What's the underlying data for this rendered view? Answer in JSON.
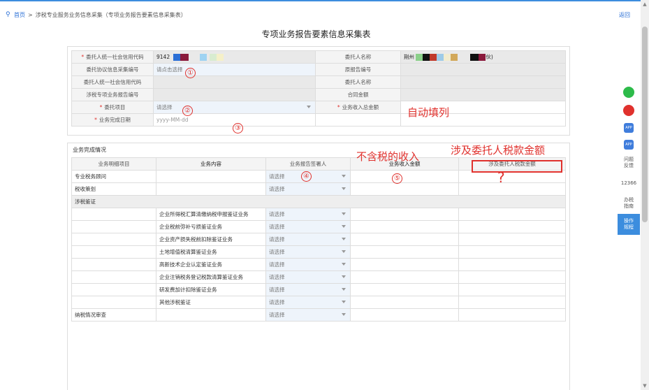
{
  "breadcrumb": {
    "home": "首页",
    "sep": ">",
    "current": "涉税专业服务业务信息采集（专项业务报告要素信息采集表）"
  },
  "return_label": "返回",
  "title": "专项业务报告要素信息采集表",
  "form": {
    "client_credit_code": {
      "label": "委托人统一社会信用代码",
      "value_prefix": "9142"
    },
    "client_name": {
      "label": "委托人名称",
      "value_prefix": "荆州",
      "value_suffix": "伙)"
    },
    "agreement_no": {
      "label": "委托协议信息采集编号",
      "placeholder": "请点击选择"
    },
    "original_report_no": {
      "label": "原报告编号"
    },
    "client_credit_code2": {
      "label": "委托人统一社会信用代码"
    },
    "client_name2": {
      "label": "委托人名称"
    },
    "special_report_no": {
      "label": "涉税专项业务报告编号"
    },
    "contract_amount": {
      "label": "合同金额"
    },
    "entrusted_item": {
      "label": "委托项目",
      "placeholder": "请选择"
    },
    "total_income": {
      "label": "业务收入总金额"
    },
    "completion_date": {
      "label": "业务完成日期",
      "placeholder": "yyyy-MM-dd"
    }
  },
  "annotations": {
    "c1": "①",
    "c2": "②",
    "c3": "③",
    "c4": "④",
    "c5": "⑤",
    "auto_fill": "自动填列",
    "excl_tax": "不含税的收入",
    "client_tax": "涉及委托人税款金额",
    "question": "?"
  },
  "completion": {
    "section_title": "业务完成情况",
    "headers": [
      "业务明细项目",
      "业务内容",
      "业务报告签署人",
      "业务收入金额",
      "涉及委托人税款金额"
    ],
    "select_placeholder": "请选择",
    "rows": [
      {
        "item": "专业税务顾问",
        "content": "",
        "type": "select"
      },
      {
        "item": "税收策划",
        "content": "",
        "type": "select"
      },
      {
        "item": "涉税鉴证",
        "content": "",
        "type": "group"
      },
      {
        "item": "",
        "content": "企业所得税汇算清缴纳税申报鉴证业务",
        "type": "select"
      },
      {
        "item": "",
        "content": "企业税前弥补亏损鉴证业务",
        "type": "select"
      },
      {
        "item": "",
        "content": "企业资产损失税前扣除鉴证业务",
        "type": "select"
      },
      {
        "item": "",
        "content": "土地增值税清算鉴证业务",
        "type": "select"
      },
      {
        "item": "",
        "content": "高新技术企业认定鉴证业务",
        "type": "select"
      },
      {
        "item": "",
        "content": "企业注销税务登记税款清算鉴证业务",
        "type": "select"
      },
      {
        "item": "",
        "content": "研发费加计扣除鉴证业务",
        "type": "select"
      },
      {
        "item": "",
        "content": "其他涉税鉴证",
        "type": "select"
      },
      {
        "item": "纳税情况审查",
        "content": "",
        "type": "select"
      }
    ]
  },
  "sidebar": {
    "app1": "APP",
    "app2": "APP",
    "feedback": "问题反馈",
    "hotline": "12366",
    "guide": "办税指南",
    "manual": "操作规程"
  },
  "colors": {
    "accent": "#3c8dde",
    "annotation": "#e0312d",
    "wechat": "#2dbb4a",
    "weibo": "#e0312d"
  }
}
